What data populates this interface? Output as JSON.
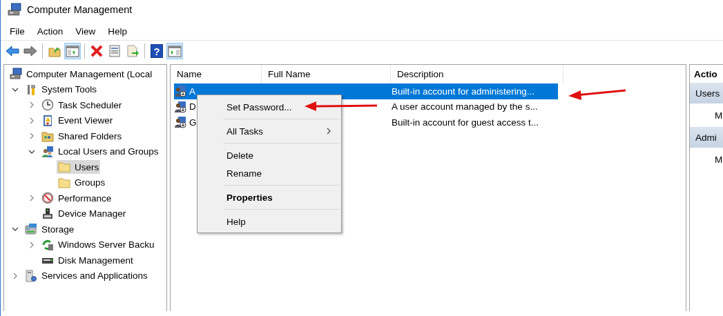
{
  "window": {
    "title": "Computer Management"
  },
  "menu": [
    "File",
    "Action",
    "View",
    "Help"
  ],
  "toolbar": [
    {
      "kind": "back",
      "pressed": false
    },
    {
      "kind": "forward",
      "pressed": false
    },
    {
      "kind": "separator"
    },
    {
      "kind": "up",
      "pressed": false
    },
    {
      "kind": "tree-toggle",
      "pressed": true
    },
    {
      "kind": "separator"
    },
    {
      "kind": "delete",
      "pressed": false
    },
    {
      "kind": "properties",
      "pressed": false
    },
    {
      "kind": "export",
      "pressed": false
    },
    {
      "kind": "separator"
    },
    {
      "kind": "help",
      "pressed": false,
      "glyph": "?"
    },
    {
      "kind": "action-toggle",
      "pressed": true
    }
  ],
  "tree": [
    {
      "label": "Computer Management (Local",
      "kind": "computer",
      "selected": false,
      "children": [
        {
          "label": "System Tools",
          "kind": "tools",
          "expanded": true,
          "selected": false,
          "children": [
            {
              "label": "Task Scheduler",
              "kind": "clock",
              "expanded": false,
              "selected": false
            },
            {
              "label": "Event Viewer",
              "kind": "event",
              "expanded": false,
              "selected": false
            },
            {
              "label": "Shared Folders",
              "kind": "share",
              "expanded": false,
              "selected": false
            },
            {
              "label": "Local Users and Groups",
              "kind": "users",
              "expanded": true,
              "selected": false,
              "children": [
                {
                  "label": "Users",
                  "kind": "folder",
                  "selected": true
                },
                {
                  "label": "Groups",
                  "kind": "folder",
                  "selected": false
                }
              ]
            },
            {
              "label": "Performance",
              "kind": "perf",
              "expanded": false,
              "selected": false
            },
            {
              "label": "Device Manager",
              "kind": "device",
              "selected": false
            }
          ]
        },
        {
          "label": "Storage",
          "kind": "storage",
          "expanded": true,
          "selected": false,
          "children": [
            {
              "label": "Windows Server Backu",
              "kind": "backup",
              "expanded": false,
              "selected": false
            },
            {
              "label": "Disk Management",
              "kind": "disk",
              "selected": false
            }
          ]
        },
        {
          "label": "Services and Applications",
          "kind": "services",
          "expanded": false,
          "selected": false
        }
      ]
    }
  ],
  "table": {
    "columns": [
      "Name",
      "Full Name",
      "Description"
    ],
    "rows": [
      {
        "name": "A",
        "full_name": "",
        "description": "Built-in account for administering...",
        "selected": true
      },
      {
        "name": "D",
        "full_name": "",
        "description": "A user account managed by the s...",
        "selected": false
      },
      {
        "name": "G",
        "full_name": "",
        "description": "Built-in account for guest access t...",
        "selected": false
      }
    ]
  },
  "context_menu": [
    {
      "kind": "item",
      "label": "Set Password...",
      "default": false,
      "submenu": false
    },
    {
      "kind": "separator"
    },
    {
      "kind": "item",
      "label": "All Tasks",
      "default": false,
      "submenu": true
    },
    {
      "kind": "separator"
    },
    {
      "kind": "item",
      "label": "Delete",
      "default": false,
      "submenu": false
    },
    {
      "kind": "item",
      "label": "Rename",
      "default": false,
      "submenu": false
    },
    {
      "kind": "separator"
    },
    {
      "kind": "item",
      "label": "Properties",
      "default": true,
      "submenu": false
    },
    {
      "kind": "separator"
    },
    {
      "kind": "item",
      "label": "Help",
      "default": false,
      "submenu": false
    }
  ],
  "actions": {
    "title": "Actio",
    "sections": [
      {
        "title": "Users",
        "items": [
          "M"
        ]
      },
      {
        "title": "Admi",
        "items": [
          "M"
        ]
      }
    ]
  }
}
